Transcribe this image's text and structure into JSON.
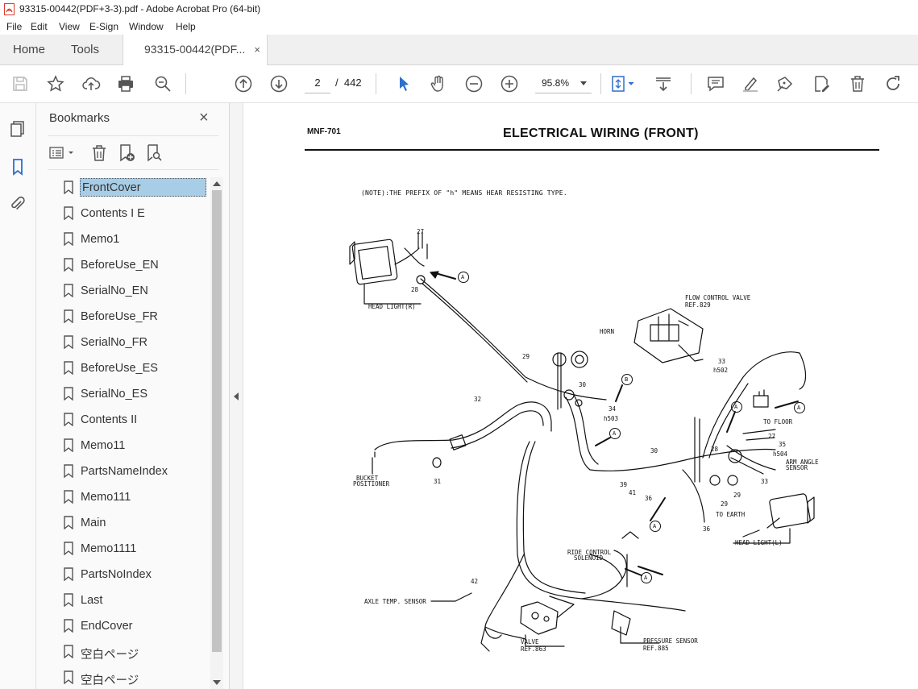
{
  "window": {
    "title": "93315-00442(PDF+3-3).pdf - Adobe Acrobat Pro (64-bit)"
  },
  "menu": [
    "File",
    "Edit",
    "View",
    "E-Sign",
    "Window",
    "Help"
  ],
  "tabs": {
    "home": "Home",
    "tools": "Tools",
    "document": "93315-00442(PDF...",
    "close_glyph": "×"
  },
  "toolbar": {
    "page_current": "2",
    "page_separator": "/",
    "page_total": "442",
    "zoom": "95.8%"
  },
  "panel": {
    "title": "Bookmarks",
    "close_glyph": "×",
    "bookmarks": [
      {
        "label": "FrontCover",
        "selected": true
      },
      {
        "label": "Contents I E"
      },
      {
        "label": "Memo1"
      },
      {
        "label": "BeforeUse_EN"
      },
      {
        "label": "SerialNo_EN"
      },
      {
        "label": "BeforeUse_FR"
      },
      {
        "label": "SerialNo_FR"
      },
      {
        "label": "BeforeUse_ES"
      },
      {
        "label": "SerialNo_ES"
      },
      {
        "label": "Contents II"
      },
      {
        "label": "Memo11"
      },
      {
        "label": "PartsNameIndex"
      },
      {
        "label": "Memo111"
      },
      {
        "label": "Main"
      },
      {
        "label": "Memo1111"
      },
      {
        "label": "PartsNoIndex"
      },
      {
        "label": "Last"
      },
      {
        "label": "EndCover"
      },
      {
        "label": "空白ページ"
      },
      {
        "label": "空白ページ"
      }
    ]
  },
  "document": {
    "model_code": "MNF-701",
    "title": "ELECTRICAL WIRING (FRONT)",
    "note": "(NOTE):THE PREFIX OF \"h\" MEANS HEAR RESISTING TYPE.",
    "labels": {
      "head_light_r": "HEAD LIGHT(R)",
      "flow_control_valve": "FLOW CONTROL VALVE",
      "ref_829": "REF.829",
      "horn": "HORN",
      "to_floor": "TO FLOOR",
      "arm_angle_sensor_1": "ARM ANGLE",
      "arm_angle_sensor_2": "SENSOR",
      "to_earth": "TO EARTH",
      "head_light_l": "HEAD LIGHT(L)",
      "bucket_positioner_1": "BUCKET",
      "bucket_positioner_2": "POSITIONER",
      "ride_control_1": "RIDE CONTROL",
      "ride_control_2": "SOLENOID",
      "axle_temp_sensor": "AXLE TEMP. SENSOR",
      "valve": "VALVE",
      "ref_863": "REF.863",
      "pressure_sensor": "PRESSURE SENSOR",
      "ref_885": "REF.885",
      "n27a": "27",
      "n28a": "28",
      "n29a": "29",
      "n30a": "30",
      "n32": "32",
      "n31": "31",
      "n33": "33",
      "h502": "h502",
      "n34": "34",
      "h503": "h503",
      "n30b": "30",
      "n28b": "28",
      "n27b": "27",
      "n35a": "35",
      "h504": "h504",
      "n33b": "33",
      "n29b": "29",
      "n29c": "29",
      "n39": "39",
      "n41": "41",
      "n36a": "36",
      "n36b": "36",
      "n42": "42",
      "ca1": "A",
      "ca2": "A",
      "ca3": "A",
      "ca4": "A",
      "ca5": "A",
      "ca6": "A",
      "cb": "B"
    }
  },
  "colors": {
    "selected_bookmark": "#a8cde6",
    "accent_blue": "#2c6fce",
    "pdf_red": "#d83b2b"
  }
}
